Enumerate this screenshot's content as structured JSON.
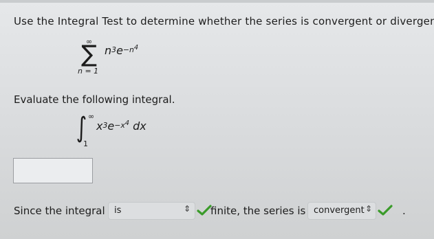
{
  "prompt": "Use the Integral Test to determine whether the series is convergent or divergent.",
  "series": {
    "sum_upper": "∞",
    "sum_lower": "n = 1",
    "term_base": "n",
    "term_exp": "3",
    "term_e": "e",
    "term_exp_neg": "−n",
    "term_exp_exp": "4"
  },
  "evaluate_label": "Evaluate the following integral.",
  "integral": {
    "upper": "∞",
    "lower": "1",
    "base": "x",
    "exp": "3",
    "e": "e",
    "exp_neg": "−x",
    "exp_exp": "4",
    "dx": "dx"
  },
  "answer_input": {
    "value": ""
  },
  "conclusion": {
    "since_text": "Since the integral",
    "select1": {
      "value": "is"
    },
    "middle_text": "finite, the series is",
    "select2": {
      "value": "convergent"
    },
    "end_text": "."
  },
  "icons": {
    "chevron": "updown-chevron-icon",
    "check": "checkmark-icon"
  },
  "colors": {
    "check_green": "#3a9b2a",
    "background": "#dfe1e3"
  }
}
